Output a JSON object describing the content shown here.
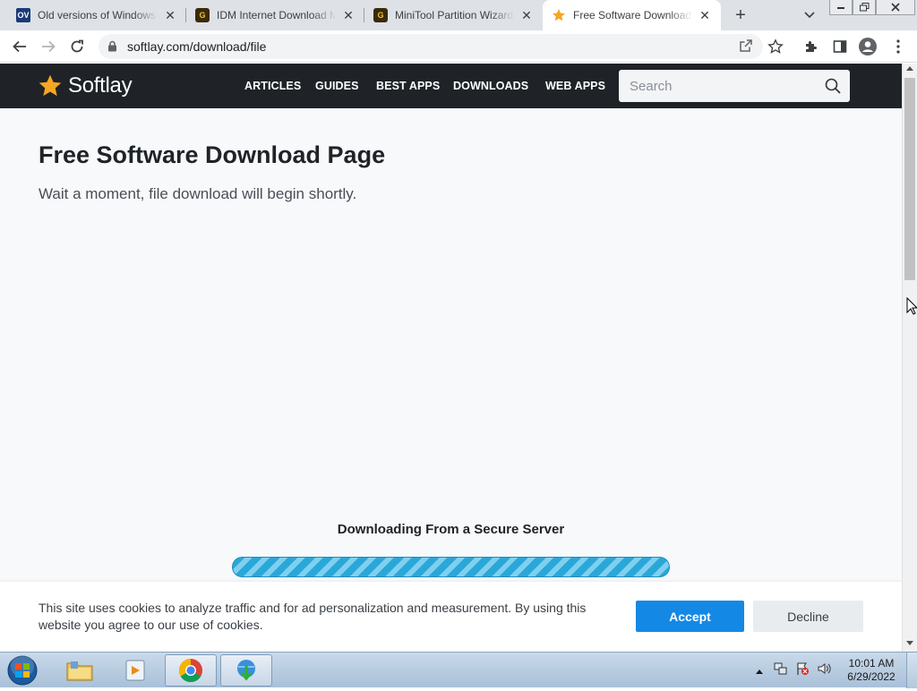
{
  "browser": {
    "tabs": [
      {
        "title": "Old versions of Windows",
        "favicon": "OV",
        "active": false
      },
      {
        "title": "IDM Internet Download M",
        "favicon": "G",
        "active": false
      },
      {
        "title": "MiniTool Partition Wizard",
        "favicon": "G",
        "active": false
      },
      {
        "title": "Free Software Download",
        "favicon": "star-icon",
        "active": true
      }
    ],
    "url": "softlay.com/download/file"
  },
  "site": {
    "logo_text": "Softlay",
    "nav": [
      "ARTICLES",
      "GUIDES",
      "BEST APPS",
      "DOWNLOADS",
      "WEB APPS"
    ],
    "search_placeholder": "Search"
  },
  "page": {
    "title": "Free Software Download Page",
    "subtitle": "Wait a moment, file download will begin shortly.",
    "download_heading": "Downloading From a Secure Server"
  },
  "cookie": {
    "text": "This site uses cookies to analyze traffic and for ad personalization and measurement. By using this website you agree to our use of cookies.",
    "accept_label": "Accept",
    "decline_label": "Decline"
  },
  "taskbar": {
    "time": "10:01 AM",
    "date": "6/29/2022"
  },
  "colors": {
    "site_header": "#1f2327",
    "accent": "#1488e5",
    "logo_star": "#f5a623",
    "progress": "#2aa7d9"
  }
}
